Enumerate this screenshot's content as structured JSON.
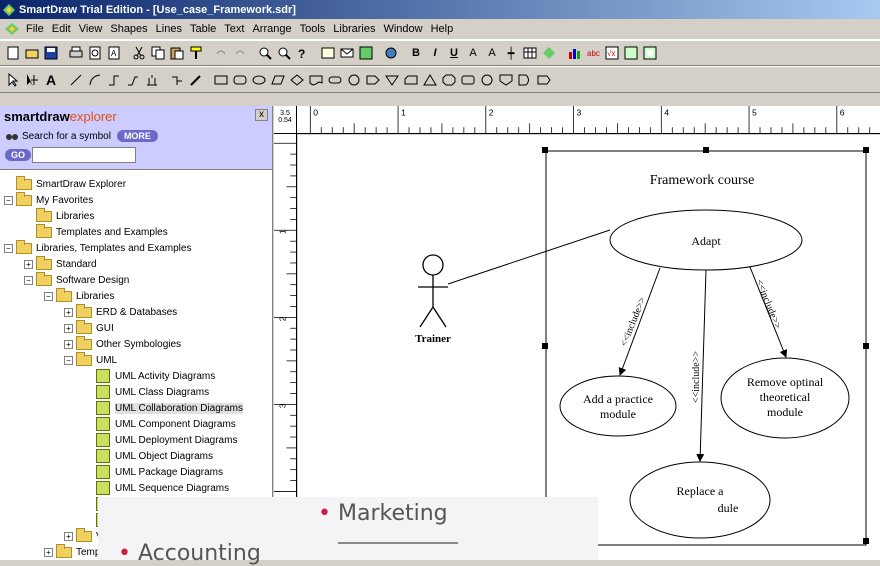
{
  "window": {
    "title": "SmartDraw Trial Edition - [Use_case_Framework.sdr]"
  },
  "menu": [
    "File",
    "Edit",
    "View",
    "Shapes",
    "Lines",
    "Table",
    "Text",
    "Arrange",
    "Tools",
    "Libraries",
    "Window",
    "Help"
  ],
  "explorer": {
    "logo_bold": "smartdraw",
    "logo_light": "explorer",
    "close": "x",
    "search_label": "Search for a symbol",
    "more": "MORE",
    "go": "GO",
    "search_value": ""
  },
  "tree": [
    {
      "label": "SmartDraw Explorer",
      "level": 0,
      "pm": ""
    },
    {
      "label": "My Favorites",
      "level": 0,
      "pm": "−"
    },
    {
      "label": "Libraries",
      "level": 1,
      "pm": ""
    },
    {
      "label": "Templates and Examples",
      "level": 1,
      "pm": ""
    },
    {
      "label": "Libraries, Templates and Examples",
      "level": 0,
      "pm": "−"
    },
    {
      "label": "Standard",
      "level": 1,
      "pm": "+"
    },
    {
      "label": "Software Design",
      "level": 1,
      "pm": "−"
    },
    {
      "label": "Libraries",
      "level": 2,
      "pm": "−"
    },
    {
      "label": "ERD & Databases",
      "level": 3,
      "pm": "+"
    },
    {
      "label": "GUI",
      "level": 3,
      "pm": "+"
    },
    {
      "label": "Other Symbologies",
      "level": 3,
      "pm": "+"
    },
    {
      "label": "UML",
      "level": 3,
      "pm": "−"
    },
    {
      "label": "UML Activity Diagrams",
      "level": 4,
      "pm": "",
      "uml": true
    },
    {
      "label": "UML Class Diagrams",
      "level": 4,
      "pm": "",
      "uml": true
    },
    {
      "label": "UML Collaboration Diagrams",
      "level": 4,
      "pm": "",
      "uml": true,
      "selected": true
    },
    {
      "label": "UML Component Diagrams",
      "level": 4,
      "pm": "",
      "uml": true
    },
    {
      "label": "UML Deployment Diagrams",
      "level": 4,
      "pm": "",
      "uml": true
    },
    {
      "label": "UML Object Diagrams",
      "level": 4,
      "pm": "",
      "uml": true
    },
    {
      "label": "UML Package Diagrams",
      "level": 4,
      "pm": "",
      "uml": true
    },
    {
      "label": "UML Sequence Diagrams",
      "level": 4,
      "pm": "",
      "uml": true
    },
    {
      "label": "",
      "level": 4,
      "pm": "",
      "uml": true
    },
    {
      "label": "",
      "level": 4,
      "pm": "",
      "uml": true
    },
    {
      "label": "V",
      "level": 3,
      "pm": "+"
    },
    {
      "label": "Temp",
      "level": 2,
      "pm": "+"
    }
  ],
  "ruler": {
    "corner_top": "3.5",
    "corner_bottom": "0.54",
    "h": [
      "0",
      "1",
      "2",
      "3",
      "4",
      "5",
      "6"
    ],
    "v": [
      "1",
      "2",
      "3"
    ]
  },
  "diagram": {
    "boundary_title": "Framework course",
    "actor": "Trainer",
    "uc_adapt": "Adapt",
    "uc_add_1": "Add a practice",
    "uc_add_2": "module",
    "uc_remove_1": "Remove optinal",
    "uc_remove_2": "theoretical",
    "uc_remove_3": "module",
    "uc_replace_1": "Replace a",
    "uc_replace_2": "dule",
    "include": "<<include>>"
  },
  "overlay": {
    "line1": "Marketing",
    "line2": "Accounting"
  }
}
